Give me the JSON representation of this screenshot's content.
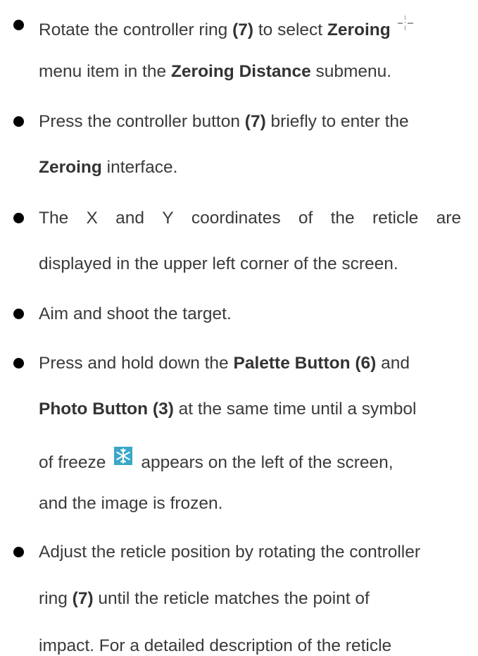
{
  "items": [
    {
      "lines": [
        {
          "parts": [
            {
              "t": "Rotate the controller ring ",
              "b": false
            },
            {
              "t": "(7)",
              "b": true
            },
            {
              "t": " to select ",
              "b": false
            },
            {
              "t": "Zeroing",
              "b": true
            }
          ],
          "icon": "crosshair-icon"
        },
        {
          "parts": [
            {
              "t": "menu item in the ",
              "b": false
            },
            {
              "t": "Zeroing Distance",
              "b": true
            },
            {
              "t": " submenu.",
              "b": false
            }
          ]
        }
      ]
    },
    {
      "lines": [
        {
          "parts": [
            {
              "t": "Press the controller button ",
              "b": false
            },
            {
              "t": "(7)",
              "b": true
            },
            {
              "t": " briefly to enter the",
              "b": false
            }
          ]
        },
        {
          "parts": [
            {
              "t": "Zeroing",
              "b": true
            },
            {
              "t": " interface.",
              "b": false
            }
          ]
        }
      ]
    },
    {
      "lines": [
        {
          "words": [
            "The",
            "X",
            "and",
            "Y",
            "coordinates",
            "of",
            "the",
            "reticle",
            "are"
          ]
        },
        {
          "parts": [
            {
              "t": "displayed in the upper left corner of the screen.",
              "b": false
            }
          ]
        }
      ]
    },
    {
      "lines": [
        {
          "parts": [
            {
              "t": "Aim and shoot the target.",
              "b": false
            }
          ]
        }
      ]
    },
    {
      "lines": [
        {
          "parts": [
            {
              "t": "Press and hold down the ",
              "b": false
            },
            {
              "t": "Palette Button (6)",
              "b": true
            },
            {
              "t": " and",
              "b": false
            }
          ]
        },
        {
          "parts": [
            {
              "t": "Photo Button (3)",
              "b": true
            },
            {
              "t": " at the same time until a symbol",
              "b": false
            }
          ]
        },
        {
          "parts": [
            {
              "t": "of freeze",
              "b": false
            }
          ],
          "icon": "freeze-icon",
          "after": "appears on the left of the screen,"
        },
        {
          "parts": [
            {
              "t": "and the image is frozen.",
              "b": false
            }
          ]
        }
      ]
    },
    {
      "lines": [
        {
          "parts": [
            {
              "t": "Adjust the reticle position by rotating the controller",
              "b": false
            }
          ]
        },
        {
          "parts": [
            {
              "t": "ring ",
              "b": false
            },
            {
              "t": "(7)",
              "b": true
            },
            {
              "t": " until the reticle matches the point of",
              "b": false
            }
          ]
        },
        {
          "parts": [
            {
              "t": "impact. For a detailed description of the reticle",
              "b": false
            }
          ]
        }
      ]
    }
  ],
  "colors": {
    "text": "#3a3a3a",
    "bullet": "#000000",
    "freeze_icon_bg": "#3aa7c8",
    "crosshair": "#9a9a9a"
  }
}
